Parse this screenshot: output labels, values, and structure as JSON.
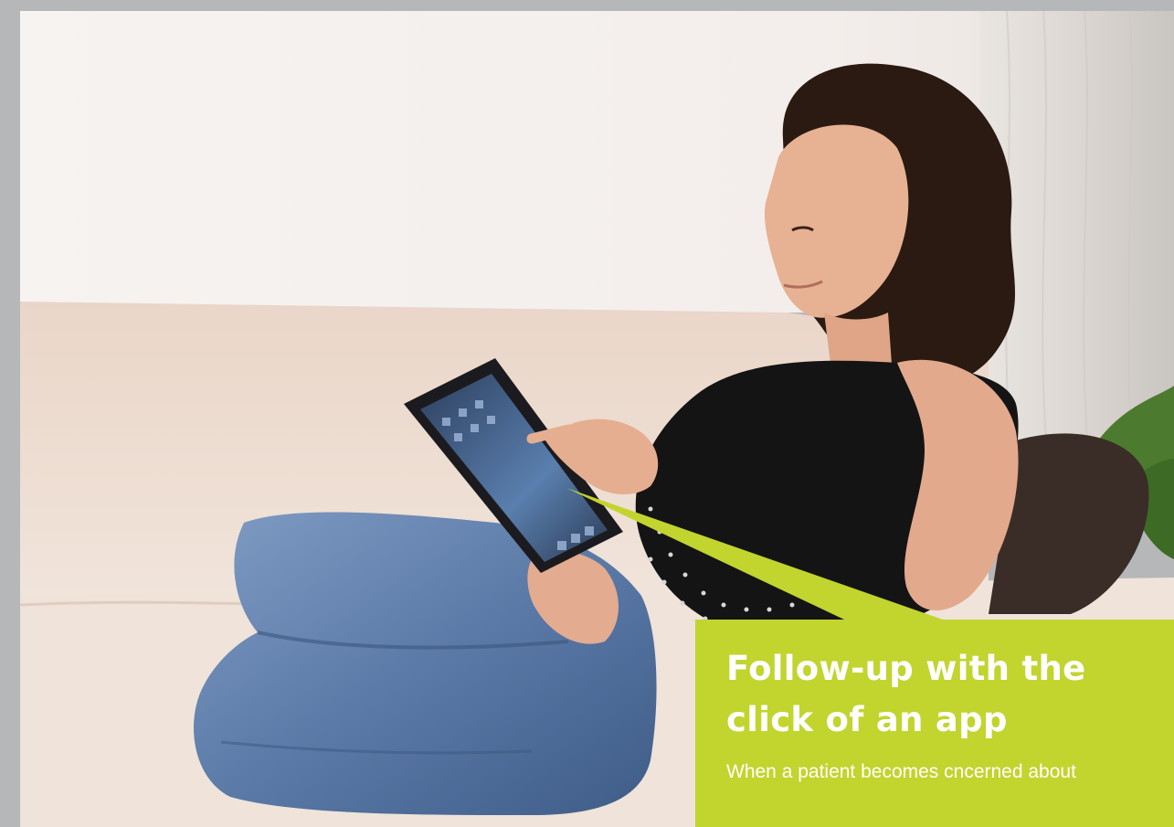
{
  "photo": {
    "subject": "woman-using-tablet-on-sofa",
    "colors": {
      "wall": "#f4efec",
      "sofa": "#ecd9cc",
      "jeans": "#5a7aa8",
      "top": "#141414",
      "skin": "#e7b193",
      "hair": "#2a1a12",
      "tablet": "#1b1b1f",
      "screen": "#4f6f9c"
    }
  },
  "callout": {
    "title_line1": "Follow-up with the",
    "title_line2": "click of an app",
    "body": "When a patient becomes cncerned about",
    "colors": {
      "background": "#c2d42e",
      "text": "#ffffff"
    }
  }
}
